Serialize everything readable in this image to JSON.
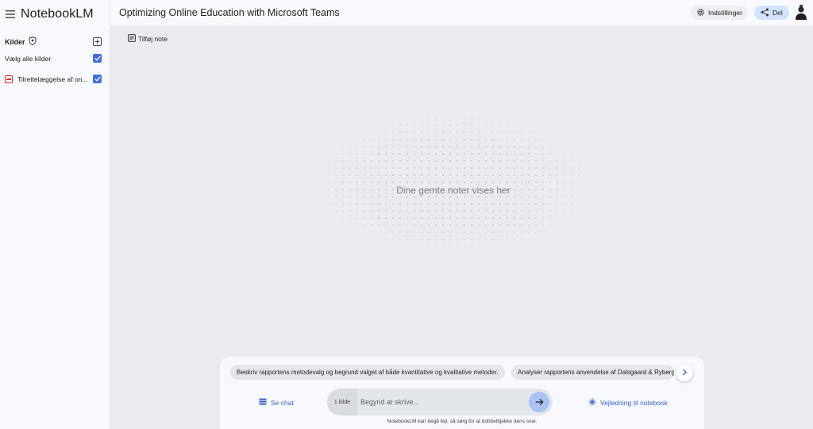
{
  "app": {
    "name": "NotebookLM"
  },
  "sidebar": {
    "sources_title": "Kilder",
    "select_all_label": "Vælg alle kilder",
    "select_all_checked": true,
    "sources": [
      {
        "type": "pdf",
        "label": "Tilrettelæggelse af on...",
        "checked": true
      }
    ]
  },
  "header": {
    "notebook_title": "Optimizing Online Education with Microsoft Teams",
    "settings_label": "Indstillinger",
    "share_label": "Del"
  },
  "notes": {
    "add_note_label": "Tilføj note",
    "empty_text": "Dine gemte noter vises her"
  },
  "chat": {
    "suggestions": [
      "Beskriv rapportens metodevalg og begrund valget af både kvantitative og kvalitative metoder.",
      "Analyser rapportens anvendelse af Dalsgaard & Ryberg"
    ],
    "see_chat_label": "Se chat",
    "source_count_label": "1 kilde",
    "input_placeholder": "Begynd at skrive...",
    "guide_label": "Vejledning til notebook",
    "disclaimer": "NotebookLM kan begå fejl, så sørg for at dobbelttjekke dens svar."
  },
  "colors": {
    "accent": "#3c6fd8",
    "share_bg": "#d3e3fd",
    "send_bg": "#a9c1f3",
    "link": "#3a5fc8"
  }
}
